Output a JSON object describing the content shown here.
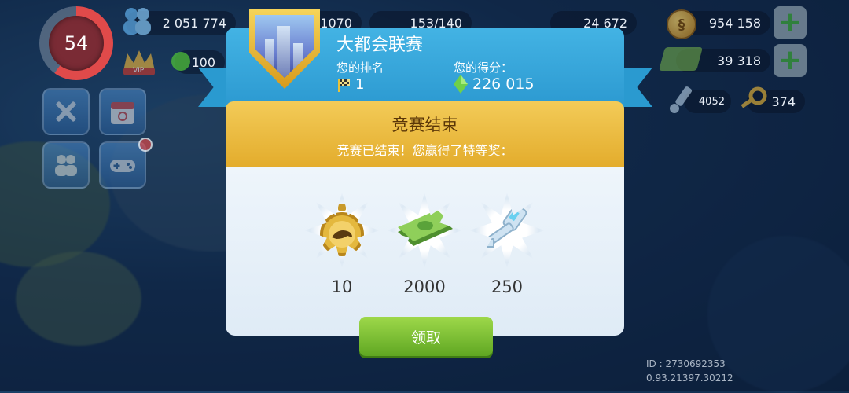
{
  "hud": {
    "level": "54",
    "population": "2 051 774",
    "happiness": "1070",
    "workers": "153/140",
    "left_value2": "100",
    "center_count": "24 672",
    "simoleons": "954 158",
    "simcash": "39 318",
    "platinum_keys": "4052",
    "golden_keys": "374",
    "vip_label": "VIP"
  },
  "modal": {
    "title": "大都会联赛",
    "rank_label": "您的排名",
    "rank_value": "1",
    "score_label": "您的得分：",
    "score_value": "226 015",
    "banner_title": "竞赛结束",
    "banner_subtitle": "竞赛已结束！您赢得了特等奖：",
    "rewards": [
      {
        "icon": "speedup-token-icon",
        "value": "10"
      },
      {
        "icon": "simcash-icon",
        "value": "2000"
      },
      {
        "icon": "platinum-key-icon",
        "value": "250"
      }
    ],
    "claim_label": "领取"
  },
  "footer": {
    "id_text": "ID : 2730692353",
    "version_text": "0.93.21397.30212"
  },
  "colors": {
    "header_blue": "#2a97cf",
    "banner_gold": "#e3ac2c",
    "claim_green": "#5fa722",
    "level_red": "#e04a4a"
  }
}
